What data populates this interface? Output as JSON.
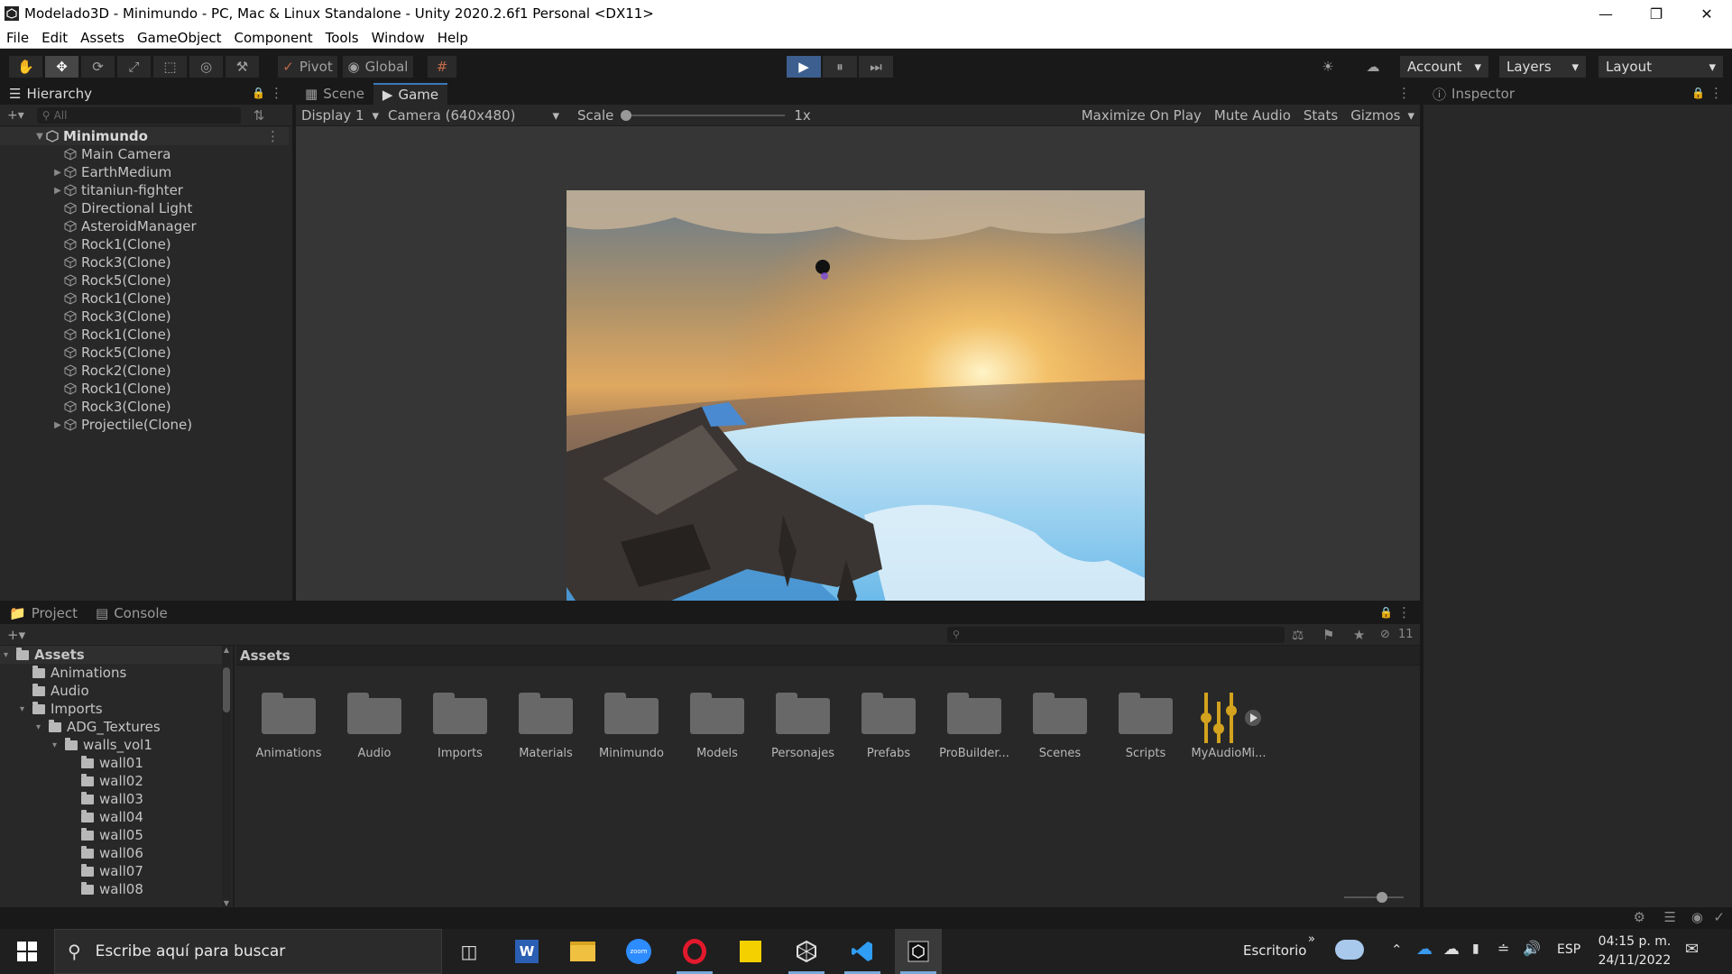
{
  "window": {
    "title": "Modelado3D - Minimundo - PC, Mac & Linux Standalone - Unity 2020.2.6f1 Personal <DX11>",
    "minimize": "—",
    "restore": "❐",
    "close": "✕"
  },
  "menu": [
    "File",
    "Edit",
    "Assets",
    "GameObject",
    "Component",
    "Tools",
    "Window",
    "Help"
  ],
  "toolbar": {
    "tools": [
      "✋",
      "✥",
      "⟳",
      "⤢",
      "⬚",
      "◎",
      "⚒"
    ],
    "pivot": "Pivot",
    "global": "Global",
    "grid": "#",
    "play": "▶",
    "pause": "⏸",
    "step": "⏭",
    "account": "Account",
    "layers": "Layers",
    "layout": "Layout",
    "dropdown_arrow": "▾"
  },
  "hierarchy": {
    "tab": "Hierarchy",
    "search_placeholder": "All",
    "add": "+▾",
    "scene": "Minimundo",
    "items": [
      {
        "label": "Main Camera",
        "expandable": false
      },
      {
        "label": "EarthMedium",
        "expandable": true
      },
      {
        "label": "titaniun-fighter",
        "expandable": true
      },
      {
        "label": "Directional Light",
        "expandable": false
      },
      {
        "label": "AsteroidManager",
        "expandable": false
      },
      {
        "label": "Rock1(Clone)",
        "expandable": false
      },
      {
        "label": "Rock3(Clone)",
        "expandable": false
      },
      {
        "label": "Rock5(Clone)",
        "expandable": false
      },
      {
        "label": "Rock1(Clone)",
        "expandable": false
      },
      {
        "label": "Rock3(Clone)",
        "expandable": false
      },
      {
        "label": "Rock1(Clone)",
        "expandable": false
      },
      {
        "label": "Rock5(Clone)",
        "expandable": false
      },
      {
        "label": "Rock2(Clone)",
        "expandable": false
      },
      {
        "label": "Rock1(Clone)",
        "expandable": false
      },
      {
        "label": "Rock3(Clone)",
        "expandable": false
      },
      {
        "label": "Projectile(Clone)",
        "expandable": true
      }
    ]
  },
  "game": {
    "tab_scene": "Scene",
    "tab_game": "Game",
    "display": "Display 1",
    "resolution": "Camera (640x480)",
    "scale_label": "Scale",
    "scale_value": "1x",
    "maximize": "Maximize On Play",
    "mute": "Mute Audio",
    "stats": "Stats",
    "gizmos": "Gizmos"
  },
  "inspector": {
    "tab": "Inspector"
  },
  "project": {
    "tab_project": "Project",
    "tab_console": "Console",
    "breadcrumb": "Assets",
    "hidden_count": "11",
    "tree": [
      {
        "label": "Assets",
        "depth": 0,
        "arrow": "▾",
        "bold": true
      },
      {
        "label": "Animations",
        "depth": 1,
        "arrow": ""
      },
      {
        "label": "Audio",
        "depth": 1,
        "arrow": ""
      },
      {
        "label": "Imports",
        "depth": 1,
        "arrow": "▾"
      },
      {
        "label": "ADG_Textures",
        "depth": 2,
        "arrow": "▾"
      },
      {
        "label": "walls_vol1",
        "depth": 3,
        "arrow": "▾"
      },
      {
        "label": "wall01",
        "depth": 4,
        "arrow": ""
      },
      {
        "label": "wall02",
        "depth": 4,
        "arrow": ""
      },
      {
        "label": "wall03",
        "depth": 4,
        "arrow": ""
      },
      {
        "label": "wall04",
        "depth": 4,
        "arrow": ""
      },
      {
        "label": "wall05",
        "depth": 4,
        "arrow": ""
      },
      {
        "label": "wall06",
        "depth": 4,
        "arrow": ""
      },
      {
        "label": "wall07",
        "depth": 4,
        "arrow": ""
      },
      {
        "label": "wall08",
        "depth": 4,
        "arrow": ""
      }
    ],
    "folders": [
      "Animations",
      "Audio",
      "Imports",
      "Materials",
      "Minimundo",
      "Models",
      "Personajes",
      "Prefabs",
      "ProBuilder...",
      "Scenes",
      "Scripts"
    ],
    "mixer": "MyAudioMi..."
  },
  "taskbar": {
    "search_placeholder": "Escribe aquí para buscar",
    "desktop": "Escritorio",
    "language": "ESP",
    "time": "04:15 p. m.",
    "date": "24/11/2022"
  }
}
